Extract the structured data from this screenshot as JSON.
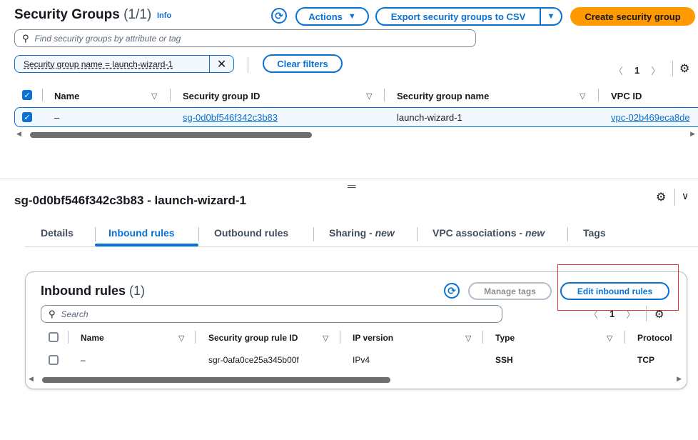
{
  "header": {
    "title": "Security Groups",
    "count": "(1/1)",
    "info": "Info",
    "actions_label": "Actions",
    "export_label": "Export security groups to CSV",
    "create_label": "Create security group"
  },
  "search": {
    "placeholder": "Find security groups by attribute or tag"
  },
  "filter": {
    "token": "Security group name = launch-wizard-1",
    "clear_label": "Clear filters"
  },
  "pager_top": {
    "page": "1"
  },
  "groups_table": {
    "columns": [
      "Name",
      "Security group ID",
      "Security group name",
      "VPC ID"
    ],
    "rows": [
      {
        "name": "–",
        "sg_id": "sg-0d0bf546f342c3b83",
        "sg_name": "launch-wizard-1",
        "vpc_id": "vpc-02b469eca8de"
      }
    ]
  },
  "detail": {
    "title": "sg-0d0bf546f342c3b83 - launch-wizard-1",
    "tabs": [
      {
        "label": "Details"
      },
      {
        "label": "Inbound rules"
      },
      {
        "label": "Outbound rules"
      },
      {
        "label": "Sharing - ",
        "suffix": "new"
      },
      {
        "label": "VPC associations - ",
        "suffix": "new"
      },
      {
        "label": "Tags"
      }
    ]
  },
  "inbound": {
    "title": "Inbound rules",
    "count": "(1)",
    "manage_tags_label": "Manage tags",
    "edit_label": "Edit inbound rules",
    "search_placeholder": "Search",
    "page": "1",
    "columns": [
      "Name",
      "Security group rule ID",
      "IP version",
      "Type",
      "Protocol"
    ],
    "rows": [
      {
        "name": "–",
        "rule_id": "sgr-0afa0ce25a345b00f",
        "ip_version": "IPv4",
        "type": "SSH",
        "protocol": "TCP"
      }
    ]
  },
  "colors": {
    "primary": "#0972d3",
    "create_button": "#ff9900",
    "highlight_box": "#e0362f"
  }
}
